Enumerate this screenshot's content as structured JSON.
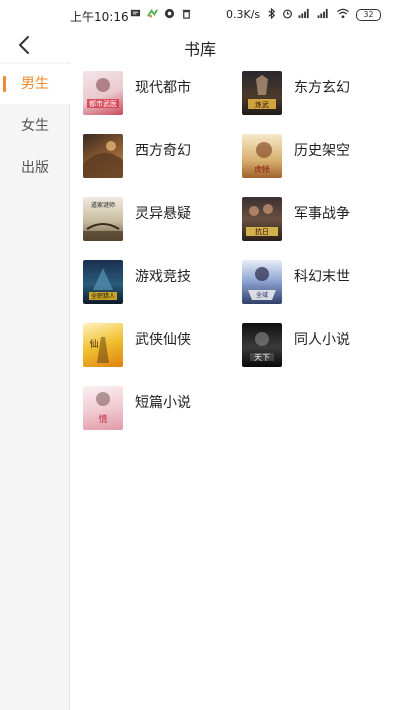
{
  "status_bar": {
    "time": "上午10:16",
    "speed": "0.3K/s",
    "battery": "32"
  },
  "header": {
    "title": "书库",
    "back_icon": "chevron-left-icon"
  },
  "sidebar": {
    "items": [
      {
        "label": "男生",
        "active": true
      },
      {
        "label": "女生",
        "active": false
      },
      {
        "label": "出版",
        "active": false
      }
    ]
  },
  "categories": [
    {
      "label": "现代都市",
      "cover_text": "都市武医"
    },
    {
      "label": "东方玄幻",
      "cover_text": "炼武"
    },
    {
      "label": "西方奇幻",
      "cover_text": ""
    },
    {
      "label": "历史架空",
      "cover_text": "虎帐"
    },
    {
      "label": "灵异悬疑",
      "cover_text": "道家谜师"
    },
    {
      "label": "军事战争",
      "cover_text": "抗日"
    },
    {
      "label": "游戏竞技",
      "cover_text": "全职猎人"
    },
    {
      "label": "科幻末世",
      "cover_text": "全域"
    },
    {
      "label": "武侠仙侠",
      "cover_text": "仙"
    },
    {
      "label": "同人小说",
      "cover_text": "天下"
    },
    {
      "label": "短篇小说",
      "cover_text": "情"
    }
  ]
}
